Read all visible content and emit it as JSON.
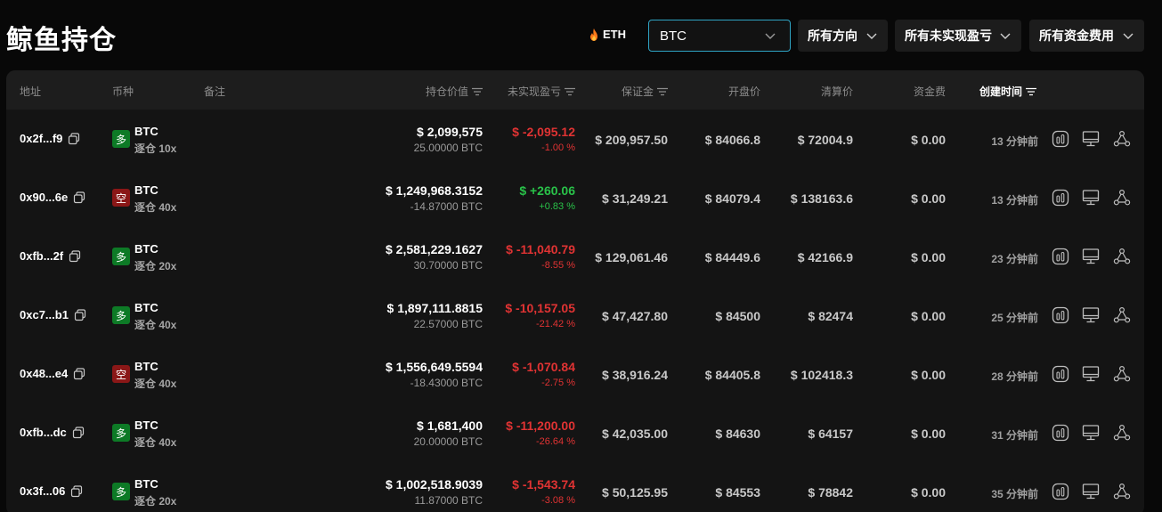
{
  "page": {
    "title": "鲸鱼持仓"
  },
  "toolbar": {
    "eth_label": "ETH",
    "coin_selected": "BTC",
    "filters": [
      "所有方向",
      "所有未实现盈亏",
      "所有资金费用"
    ]
  },
  "table": {
    "headers": {
      "address": "地址",
      "coin": "币种",
      "note": "备注",
      "value": "持仓价值",
      "pnl": "未实现盈亏",
      "margin": "保证金",
      "entry": "开盘价",
      "liq": "清算价",
      "funding": "资金费",
      "created": "创建时间"
    },
    "rows": [
      {
        "address": "0x2f...f9",
        "direction": "多",
        "dir_type": "long",
        "coin": "BTC",
        "leverage": "逐仓 10x",
        "value": "$ 2,099,575",
        "size": "25.00000 BTC",
        "pnl": "$ -2,095.12",
        "pnl_pct": "-1.00 %",
        "pnl_sign": "neg",
        "margin": "$ 209,957.50",
        "entry": "$ 84066.8",
        "liq": "$ 72004.9",
        "funding": "$ 0.00",
        "created": "13 分钟前"
      },
      {
        "address": "0x90...6e",
        "direction": "空",
        "dir_type": "short",
        "coin": "BTC",
        "leverage": "逐仓 40x",
        "value": "$ 1,249,968.3152",
        "size": "-14.87000 BTC",
        "pnl": "$ +260.06",
        "pnl_pct": "+0.83 %",
        "pnl_sign": "pos",
        "margin": "$ 31,249.21",
        "entry": "$ 84079.4",
        "liq": "$ 138163.6",
        "funding": "$ 0.00",
        "created": "13 分钟前"
      },
      {
        "address": "0xfb...2f",
        "direction": "多",
        "dir_type": "long",
        "coin": "BTC",
        "leverage": "逐仓 20x",
        "value": "$ 2,581,229.1627",
        "size": "30.70000 BTC",
        "pnl": "$ -11,040.79",
        "pnl_pct": "-8.55 %",
        "pnl_sign": "neg",
        "margin": "$ 129,061.46",
        "entry": "$ 84449.6",
        "liq": "$ 42166.9",
        "funding": "$ 0.00",
        "created": "23 分钟前"
      },
      {
        "address": "0xc7...b1",
        "direction": "多",
        "dir_type": "long",
        "coin": "BTC",
        "leverage": "逐仓 40x",
        "value": "$ 1,897,111.8815",
        "size": "22.57000 BTC",
        "pnl": "$ -10,157.05",
        "pnl_pct": "-21.42 %",
        "pnl_sign": "neg",
        "margin": "$ 47,427.80",
        "entry": "$ 84500",
        "liq": "$ 82474",
        "funding": "$ 0.00",
        "created": "25 分钟前"
      },
      {
        "address": "0x48...e4",
        "direction": "空",
        "dir_type": "short",
        "coin": "BTC",
        "leverage": "逐仓 40x",
        "value": "$ 1,556,649.5594",
        "size": "-18.43000 BTC",
        "pnl": "$ -1,070.84",
        "pnl_pct": "-2.75 %",
        "pnl_sign": "neg",
        "margin": "$ 38,916.24",
        "entry": "$ 84405.8",
        "liq": "$ 102418.3",
        "funding": "$ 0.00",
        "created": "28 分钟前"
      },
      {
        "address": "0xfb...dc",
        "direction": "多",
        "dir_type": "long",
        "coin": "BTC",
        "leverage": "逐仓 40x",
        "value": "$ 1,681,400",
        "size": "20.00000 BTC",
        "pnl": "$ -11,200.00",
        "pnl_pct": "-26.64 %",
        "pnl_sign": "neg",
        "margin": "$ 42,035.00",
        "entry": "$ 84630",
        "liq": "$ 64157",
        "funding": "$ 0.00",
        "created": "31 分钟前"
      },
      {
        "address": "0x3f...06",
        "direction": "多",
        "dir_type": "long",
        "coin": "BTC",
        "leverage": "逐仓 20x",
        "value": "$ 1,002,518.9039",
        "size": "11.87000 BTC",
        "pnl": "$ -1,543.74",
        "pnl_pct": "-3.08 %",
        "pnl_sign": "neg",
        "margin": "$ 50,125.95",
        "entry": "$ 84553",
        "liq": "$ 78842",
        "funding": "$ 0.00",
        "created": "35 分钟前"
      }
    ]
  },
  "colors": {
    "long": "#0d7a26",
    "short": "#8a1717",
    "neg": "#e03333",
    "pos": "#29c249",
    "accent": "#2fa4c4"
  },
  "icons": {
    "copy": "copy-icon",
    "chart": "chart-icon",
    "monitor": "monitor-icon",
    "share": "share-icon",
    "sort": "sort-icon",
    "chevron": "chevron-down-icon",
    "flame": "flame-icon"
  }
}
